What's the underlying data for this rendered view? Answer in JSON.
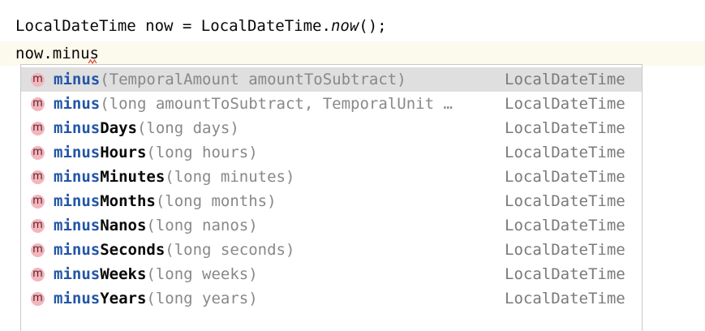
{
  "editor": {
    "line1": {
      "before_italic": "LocalDateTime now = LocalDateTime.",
      "italic": "now",
      "after_italic": "();"
    },
    "line2": {
      "text": "now.minus"
    }
  },
  "completion": {
    "colors": {
      "match": "#2255a6",
      "selected_bg": "#dfdfdf",
      "method_badge_bg": "#f2b6bc"
    },
    "items": [
      {
        "icon": "method-icon",
        "badge": "m",
        "match": "minus",
        "rest": "",
        "params": "(TemporalAmount amountToSubtract)",
        "ret": "LocalDateTime"
      },
      {
        "icon": "method-icon",
        "badge": "m",
        "match": "minus",
        "rest": "",
        "params": "(long amountToSubtract, TemporalUnit …",
        "ret": "LocalDateTime"
      },
      {
        "icon": "method-icon",
        "badge": "m",
        "match": "minus",
        "rest": "Days",
        "params": "(long days)",
        "ret": "LocalDateTime"
      },
      {
        "icon": "method-icon",
        "badge": "m",
        "match": "minus",
        "rest": "Hours",
        "params": "(long hours)",
        "ret": "LocalDateTime"
      },
      {
        "icon": "method-icon",
        "badge": "m",
        "match": "minus",
        "rest": "Minutes",
        "params": "(long minutes)",
        "ret": "LocalDateTime"
      },
      {
        "icon": "method-icon",
        "badge": "m",
        "match": "minus",
        "rest": "Months",
        "params": "(long months)",
        "ret": "LocalDateTime"
      },
      {
        "icon": "method-icon",
        "badge": "m",
        "match": "minus",
        "rest": "Nanos",
        "params": "(long nanos)",
        "ret": "LocalDateTime"
      },
      {
        "icon": "method-icon",
        "badge": "m",
        "match": "minus",
        "rest": "Seconds",
        "params": "(long seconds)",
        "ret": "LocalDateTime"
      },
      {
        "icon": "method-icon",
        "badge": "m",
        "match": "minus",
        "rest": "Weeks",
        "params": "(long weeks)",
        "ret": "LocalDateTime"
      },
      {
        "icon": "method-icon",
        "badge": "m",
        "match": "minus",
        "rest": "Years",
        "params": "(long years)",
        "ret": "LocalDateTime"
      }
    ]
  }
}
